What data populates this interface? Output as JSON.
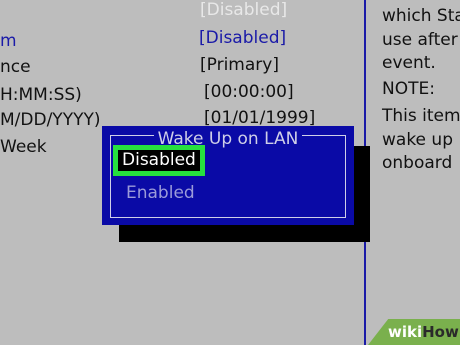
{
  "settings": {
    "rows": [
      {
        "label": "",
        "value": "[Disabled]"
      },
      {
        "label": "m",
        "value": "[Disabled]"
      },
      {
        "label": "nce",
        "value": "[Primary]"
      },
      {
        "label": "H:MM:SS)",
        "value": "[00:00:00]"
      },
      {
        "label": "M/DD/YYYY)",
        "value": "[01/01/1999]"
      },
      {
        "label": "Week",
        "value": ""
      }
    ]
  },
  "help": {
    "lines": [
      "which Sta",
      "use after",
      "event.",
      "NOTE:",
      "This item",
      "wake up",
      "onboard"
    ]
  },
  "popup": {
    "title": "Wake Up on LAN",
    "options": [
      "Disabled",
      "Enabled"
    ],
    "selected": "Disabled"
  },
  "watermark": {
    "part1": "wiki",
    "part2": "How",
    "color": "#7ab04d"
  }
}
